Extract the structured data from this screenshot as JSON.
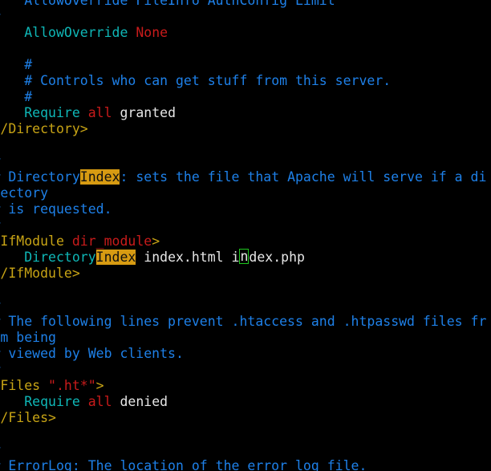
{
  "app": {
    "kind": "terminal-text-editor",
    "title": "httpd.conf",
    "background_color": "#000000",
    "font_family_kind": "monospace"
  },
  "colors": {
    "comment": "#1e80e8",
    "directive": "#0fb7b7",
    "value": "#c91b1b",
    "section_tag": "#c8a415",
    "plain_text": "#e6e6e6",
    "search_highlight_bg": "#d79b12",
    "search_highlight_fg": "#101010",
    "cursor_outline": "#1ec81e"
  },
  "search": {
    "term": "Index",
    "match_count": 2
  },
  "cursor": {
    "character": "n",
    "on_word": "index.php",
    "line_number": 16
  },
  "editor": {
    "lines": [
      {
        "id": "l1",
        "segments": [
          {
            "text": "#   AllowOverride FileInfo AuthConfig Limit",
            "style": "comment"
          }
        ]
      },
      {
        "id": "l2",
        "segments": [
          {
            "text": "#",
            "style": "comment"
          }
        ]
      },
      {
        "id": "l3",
        "segments": [
          {
            "text": "    ",
            "style": "plain"
          },
          {
            "text": "AllowOverride ",
            "style": "keyword"
          },
          {
            "text": "None",
            "style": "value"
          }
        ]
      },
      {
        "id": "l4",
        "segments": []
      },
      {
        "id": "l5",
        "segments": [
          {
            "text": "    ",
            "style": "plain"
          },
          {
            "text": "#",
            "style": "comment"
          }
        ]
      },
      {
        "id": "l6",
        "segments": [
          {
            "text": "    ",
            "style": "plain"
          },
          {
            "text": "# Controls who can get stuff from this server.",
            "style": "comment"
          }
        ]
      },
      {
        "id": "l7",
        "segments": [
          {
            "text": "    ",
            "style": "plain"
          },
          {
            "text": "#",
            "style": "comment"
          }
        ]
      },
      {
        "id": "l8",
        "segments": [
          {
            "text": "    ",
            "style": "plain"
          },
          {
            "text": "Require ",
            "style": "keyword"
          },
          {
            "text": "all ",
            "style": "value"
          },
          {
            "text": "granted",
            "style": "plain"
          }
        ]
      },
      {
        "id": "l9",
        "segments": [
          {
            "text": "</Directory>",
            "style": "tag"
          }
        ]
      },
      {
        "id": "l10",
        "segments": []
      },
      {
        "id": "l11",
        "segments": [
          {
            "text": "#",
            "style": "comment"
          }
        ]
      },
      {
        "id": "l12",
        "segments": [
          {
            "text": "# Directory",
            "style": "comment"
          },
          {
            "text": "Index",
            "style": "comment",
            "highlight": true
          },
          {
            "text": ": sets the file that Apache will serve if a di",
            "style": "comment"
          }
        ]
      },
      {
        "id": "l13",
        "segments": [
          {
            "text": "rectory",
            "style": "comment"
          }
        ]
      },
      {
        "id": "l14",
        "segments": [
          {
            "text": "# is requested.",
            "style": "comment"
          }
        ]
      },
      {
        "id": "l15",
        "segments": [
          {
            "text": "#",
            "style": "comment"
          }
        ]
      },
      {
        "id": "l16",
        "segments": [
          {
            "text": "<IfModule ",
            "style": "tag"
          },
          {
            "text": "dir_module",
            "style": "mod"
          },
          {
            "text": ">",
            "style": "tag"
          }
        ]
      },
      {
        "id": "l17",
        "segments": [
          {
            "text": "    ",
            "style": "plain"
          },
          {
            "text": "Directory",
            "style": "keyword"
          },
          {
            "text": "Index",
            "style": "keyword",
            "highlight": true
          },
          {
            "text": " index.html i",
            "style": "plain"
          },
          {
            "text": "n",
            "style": "plain",
            "cursor": true
          },
          {
            "text": "dex.php",
            "style": "plain"
          }
        ]
      },
      {
        "id": "l18",
        "segments": [
          {
            "text": "</IfModule>",
            "style": "tag"
          }
        ]
      },
      {
        "id": "l19",
        "segments": []
      },
      {
        "id": "l20",
        "segments": [
          {
            "text": "#",
            "style": "comment"
          }
        ]
      },
      {
        "id": "l21",
        "segments": [
          {
            "text": "# The following lines prevent .htaccess and .htpasswd files fr",
            "style": "comment"
          }
        ]
      },
      {
        "id": "l22",
        "segments": [
          {
            "text": "om being",
            "style": "comment"
          }
        ]
      },
      {
        "id": "l23",
        "segments": [
          {
            "text": "# viewed by Web clients.",
            "style": "comment"
          }
        ]
      },
      {
        "id": "l24",
        "segments": [
          {
            "text": "#",
            "style": "comment"
          }
        ]
      },
      {
        "id": "l25",
        "segments": [
          {
            "text": "<Files ",
            "style": "tag"
          },
          {
            "text": "\".ht*\"",
            "style": "string"
          },
          {
            "text": ">",
            "style": "tag"
          }
        ]
      },
      {
        "id": "l26",
        "segments": [
          {
            "text": "    ",
            "style": "plain"
          },
          {
            "text": "Require ",
            "style": "keyword"
          },
          {
            "text": "all ",
            "style": "value"
          },
          {
            "text": "denied",
            "style": "plain"
          }
        ]
      },
      {
        "id": "l27",
        "segments": [
          {
            "text": "</Files>",
            "style": "tag"
          }
        ]
      },
      {
        "id": "l28",
        "segments": []
      },
      {
        "id": "l29",
        "segments": [
          {
            "text": "#",
            "style": "comment"
          }
        ]
      },
      {
        "id": "l30",
        "segments": [
          {
            "text": "# ErrorLog: The location of the error log file.",
            "style": "comment"
          }
        ]
      }
    ]
  }
}
